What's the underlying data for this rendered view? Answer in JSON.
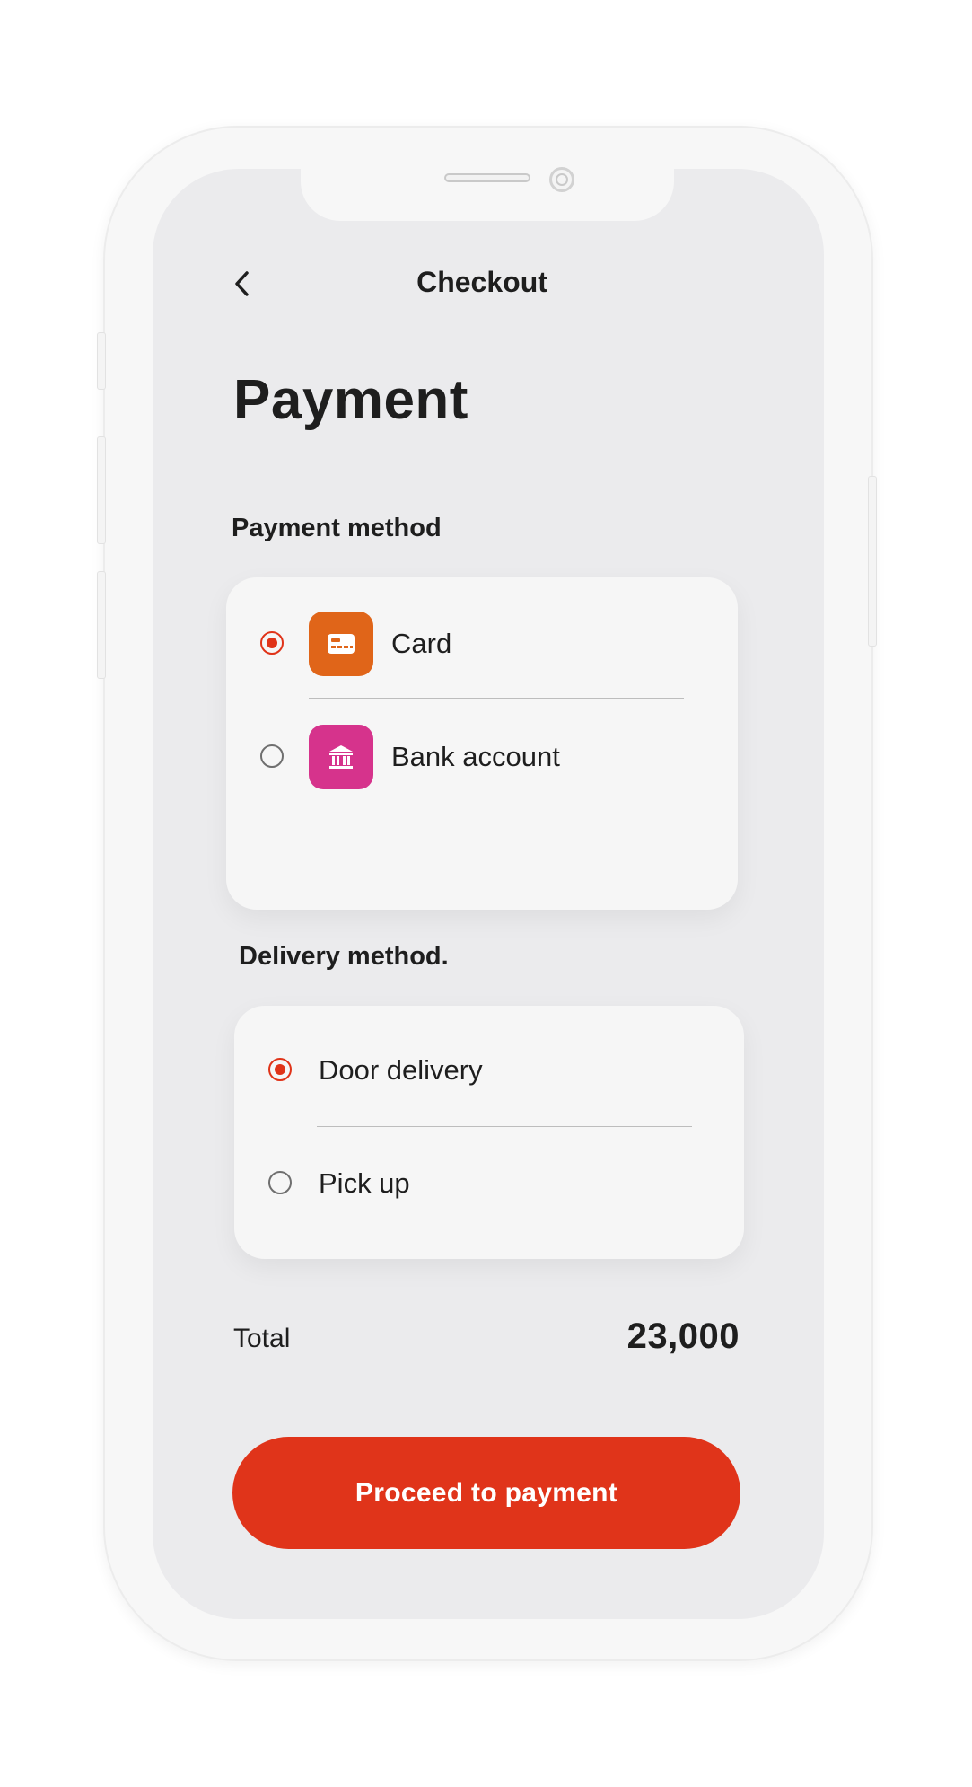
{
  "header": {
    "back_icon": "chevron-left-icon",
    "title": "Checkout"
  },
  "page": {
    "title": "Payment"
  },
  "payment_method": {
    "label": "Payment method",
    "options": [
      {
        "label": "Card",
        "icon": "credit-card-icon",
        "icon_color": "#e06519",
        "selected": true
      },
      {
        "label": "Bank account",
        "icon": "bank-icon",
        "icon_color": "#d6338c",
        "selected": false
      }
    ]
  },
  "delivery_method": {
    "label": "Delivery method.",
    "options": [
      {
        "label": "Door delivery",
        "selected": true
      },
      {
        "label": "Pick up",
        "selected": false
      }
    ]
  },
  "summary": {
    "total_label": "Total",
    "total_value": "23,000"
  },
  "actions": {
    "proceed_label": "Proceed to payment"
  },
  "colors": {
    "accent": "#e0341a",
    "card_icon": "#e06519",
    "bank_icon": "#d6338c",
    "screen_background": "#ebebed"
  }
}
